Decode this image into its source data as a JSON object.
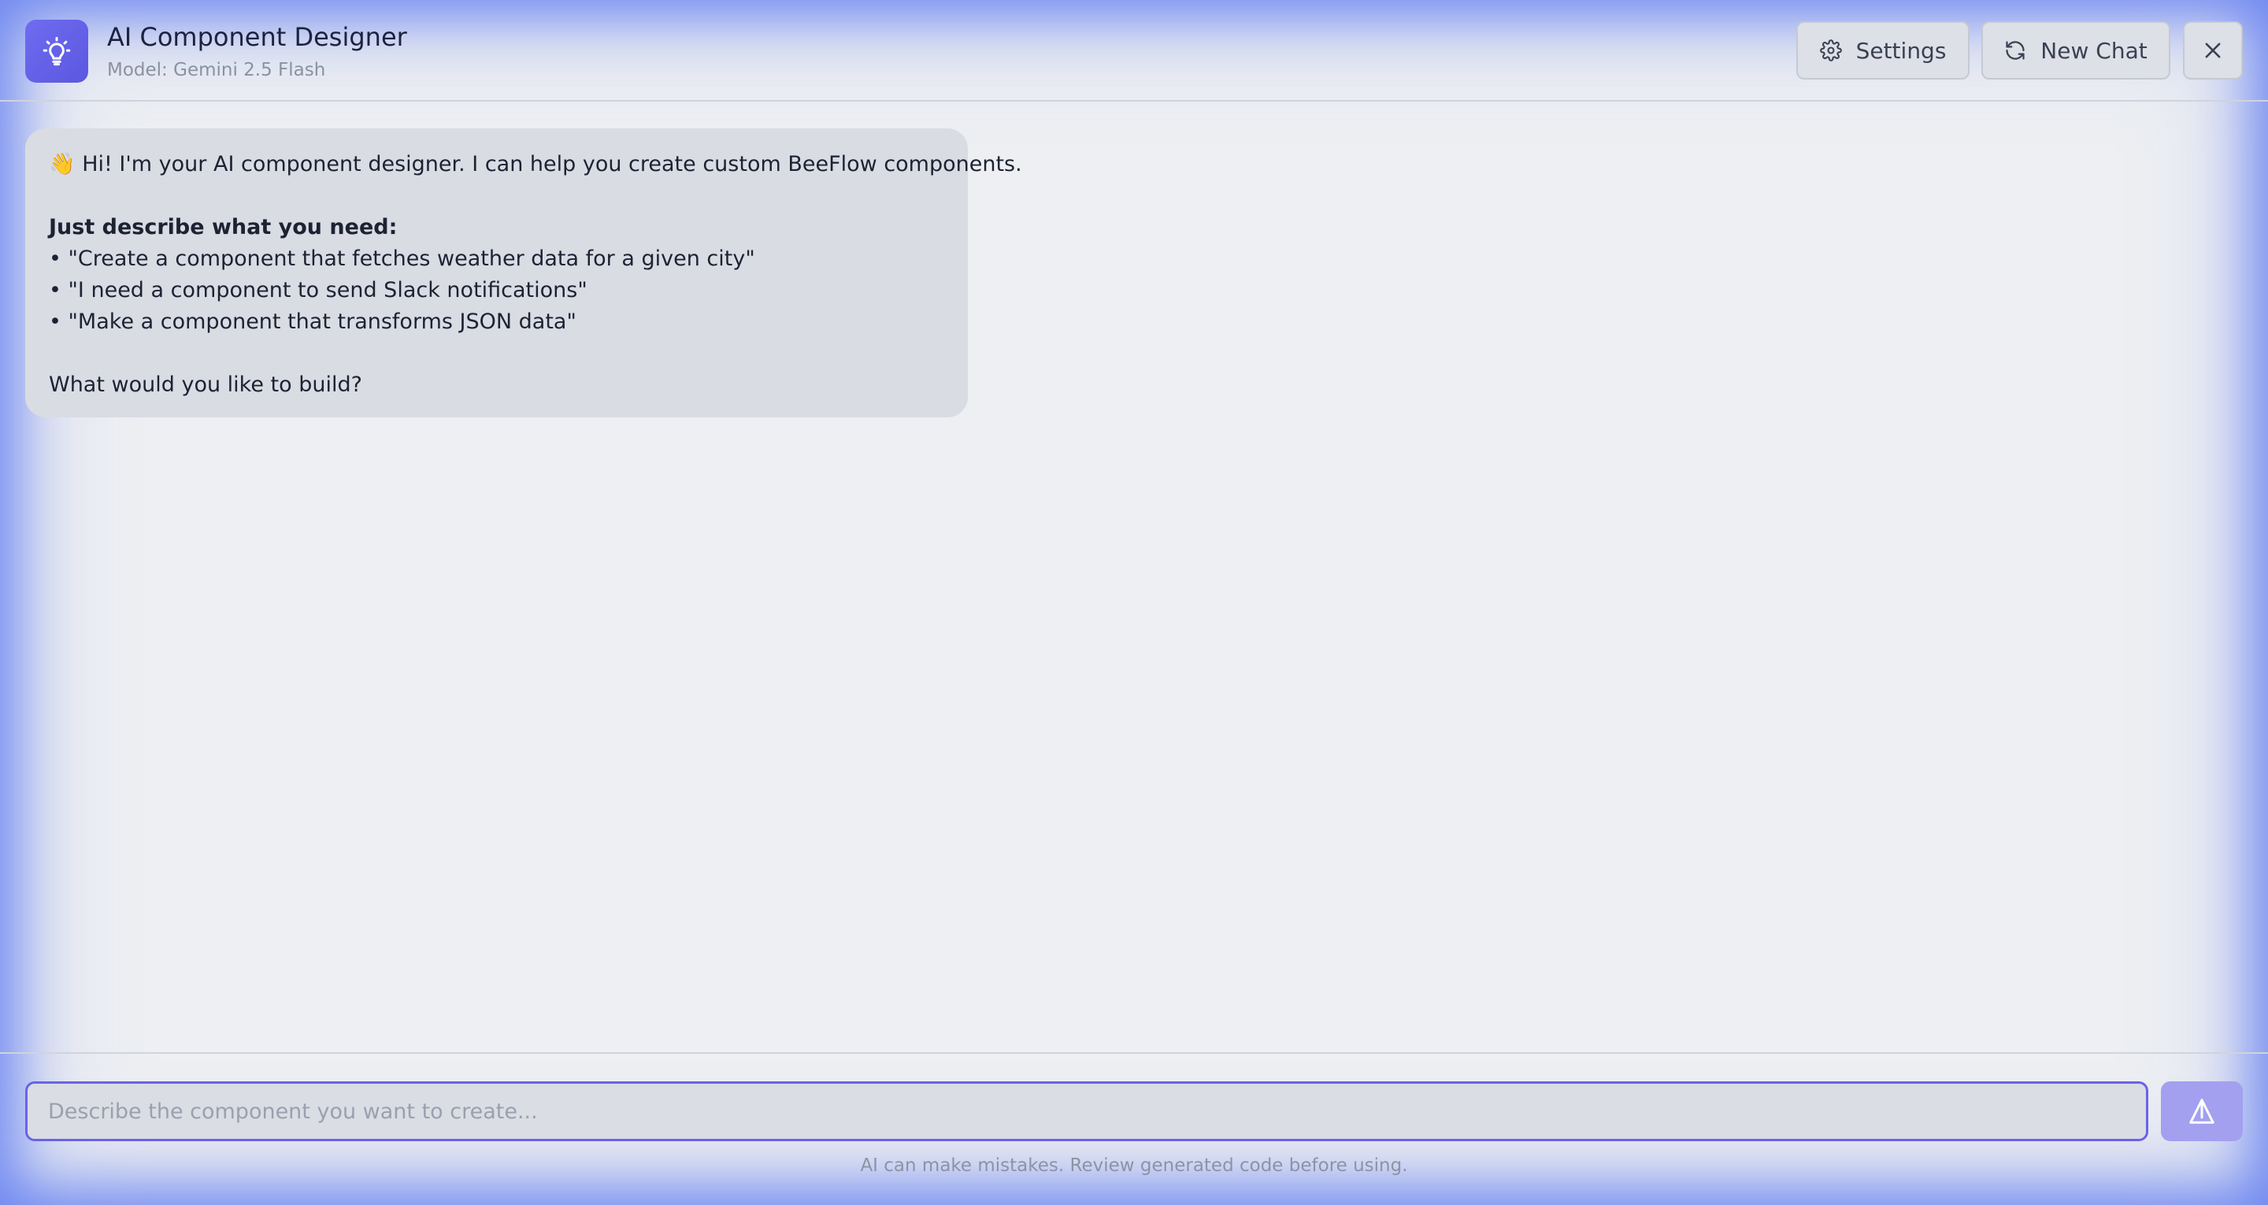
{
  "header": {
    "title": "AI Component Designer",
    "model_label": "Model: Gemini 2.5 Flash",
    "settings_label": "Settings",
    "new_chat_label": "New Chat"
  },
  "message": {
    "greeting": "👋 Hi! I'm your AI component designer. I can help you create custom BeeFlow components.",
    "heading": "Just describe what you need:",
    "examples": [
      "• \"Create a component that fetches weather data for a given city\"",
      "• \"I need a component to send Slack notifications\"",
      "• \"Make a component that transforms JSON data\""
    ],
    "question": "What would you like to build?"
  },
  "composer": {
    "placeholder": "Describe the component you want to create...",
    "value": ""
  },
  "footer": {
    "disclaimer": "AI can make mistakes. Review generated code before using."
  },
  "colors": {
    "accent": "#6a63e8",
    "logo_tile": "#6462e8",
    "send_button": "#a3a0ef",
    "glow": "#7f97ee"
  },
  "icons": {
    "logo": "lightbulb-icon",
    "settings": "gear-icon",
    "new_chat": "refresh-icon",
    "close": "close-icon",
    "send": "send-icon"
  }
}
